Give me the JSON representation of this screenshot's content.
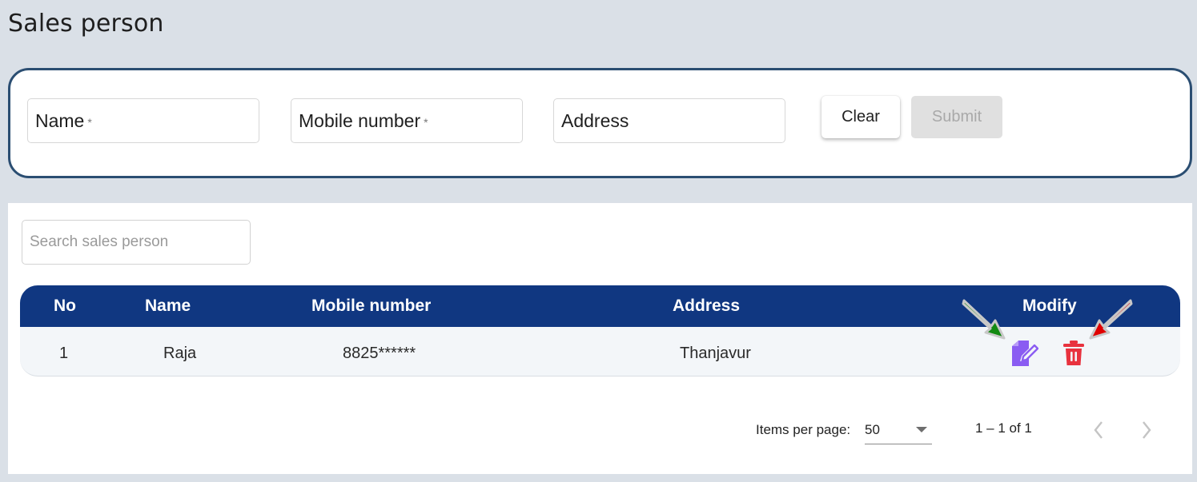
{
  "page": {
    "title": "Sales person"
  },
  "form": {
    "name_label": "Name",
    "mobile_label": "Mobile number",
    "address_label": "Address",
    "required_mark": "*",
    "clear_label": "Clear",
    "submit_label": "Submit"
  },
  "search": {
    "placeholder": "Search sales person"
  },
  "table": {
    "columns": [
      "No",
      "Name",
      "Mobile number",
      "Address",
      "Modify"
    ],
    "rows": [
      {
        "no": "1",
        "name": "Raja",
        "mobile": "8825******",
        "address": "Thanjavur"
      }
    ]
  },
  "icons": {
    "edit": "edit-icon",
    "delete": "trash-icon",
    "prev": "chevron-left-icon",
    "next": "chevron-right-icon"
  },
  "pagination": {
    "items_per_page_label": "Items per page:",
    "items_per_page_value": "50",
    "range_label": "1 – 1 of 1"
  },
  "colors": {
    "header_bg": "#103781",
    "form_border": "#2b4e72",
    "edit_icon": "#8a5cf2",
    "delete_icon": "#e8323e",
    "arrow_green": "#128a12",
    "arrow_red": "#e00000"
  }
}
